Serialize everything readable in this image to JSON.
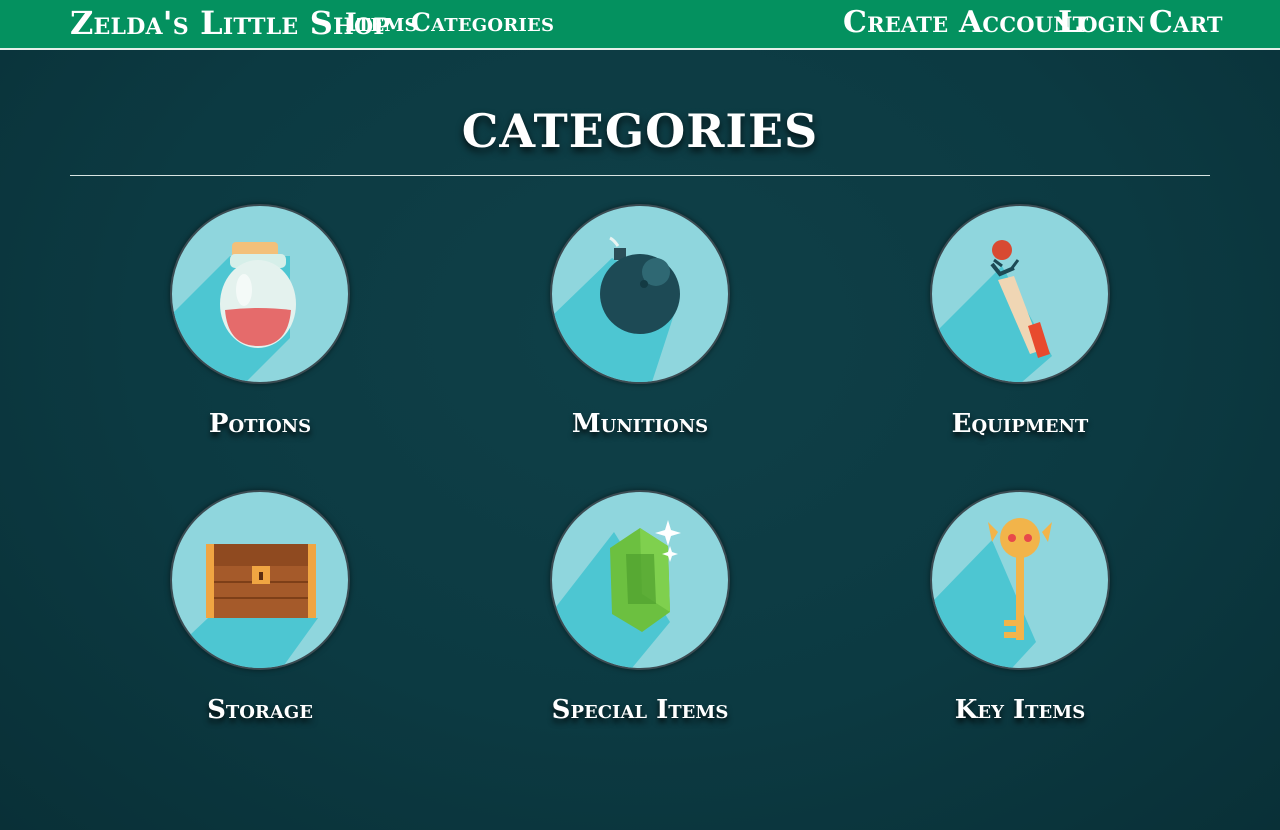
{
  "nav": {
    "brand": "Zelda's Little Shop",
    "items": "Items",
    "categories": "Categories",
    "create_account": "Create Account",
    "login": "Login",
    "cart": "Cart"
  },
  "main": {
    "title": "CATEGORIES",
    "categories": [
      {
        "label": "Potions",
        "icon": "potion-icon"
      },
      {
        "label": "Munitions",
        "icon": "bomb-icon"
      },
      {
        "label": "Equipment",
        "icon": "wand-icon"
      },
      {
        "label": "Storage",
        "icon": "treasure-chest-icon"
      },
      {
        "label": "Special Items",
        "icon": "rupee-gem-icon"
      },
      {
        "label": "Key Items",
        "icon": "skull-key-icon"
      }
    ]
  },
  "colors": {
    "navbar": "#04915f",
    "background": "#0c3a42",
    "circle": "#8fd6dd",
    "circle_shadow": "#4dc6d2"
  }
}
